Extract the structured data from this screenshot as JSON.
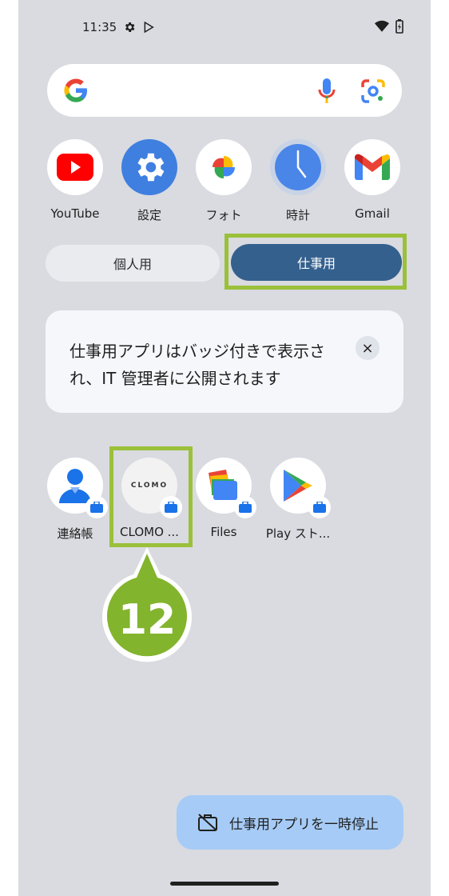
{
  "status_bar": {
    "time": "11:35",
    "icons": [
      "gear-icon",
      "play-protect-icon",
      "wifi-icon",
      "battery-icon"
    ]
  },
  "search": {
    "icons": [
      "google-g-icon",
      "mic-icon",
      "lens-icon"
    ]
  },
  "dock_apps": [
    {
      "label": "YouTube",
      "icon": "youtube-icon"
    },
    {
      "label": "設定",
      "icon": "settings-icon"
    },
    {
      "label": "フォト",
      "icon": "photos-icon"
    },
    {
      "label": "時計",
      "icon": "clock-icon"
    },
    {
      "label": "Gmail",
      "icon": "gmail-icon"
    }
  ],
  "tabs": {
    "personal": "個人用",
    "work": "仕事用",
    "selected": "work"
  },
  "notice": {
    "text": "仕事用アプリはバッジ付きで表示され、IT 管理者に公開されます",
    "close": "×"
  },
  "work_apps": [
    {
      "label": "連絡帳",
      "icon": "contacts-icon"
    },
    {
      "label": "CLOMO ...",
      "icon": "clomo-icon"
    },
    {
      "label": "Files",
      "icon": "files-icon"
    },
    {
      "label": "Play スト...",
      "icon": "play-store-icon"
    }
  ],
  "clomo_logo_text": "CLOMO",
  "callout": {
    "number": "12"
  },
  "pause_button": {
    "label": "仕事用アプリを一時停止"
  },
  "colors": {
    "highlight": "#9bc03a",
    "work_tab": "#34608e",
    "pause_button": "#a6cbf6",
    "background": "#d9dbe0"
  }
}
